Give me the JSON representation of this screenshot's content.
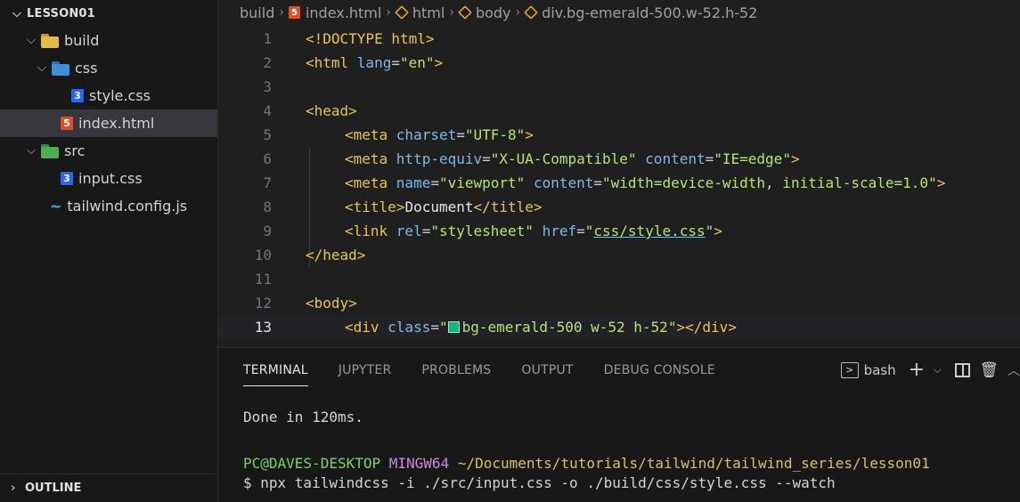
{
  "explorer": {
    "root": "LESSON01",
    "items": [
      {
        "label": "build",
        "type": "folder",
        "color": "#e8b94a"
      },
      {
        "label": "css",
        "type": "folder",
        "color": "#3f8fd6"
      },
      {
        "label": "style.css",
        "type": "css-file"
      },
      {
        "label": "index.html",
        "type": "html-file"
      },
      {
        "label": "src",
        "type": "folder",
        "color": "#4caf50"
      },
      {
        "label": "input.css",
        "type": "css-file"
      },
      {
        "label": "tailwind.config.js",
        "type": "tailwind-file"
      }
    ],
    "outline_label": "OUTLINE"
  },
  "breadcrumb": {
    "folder": "build",
    "file": "index.html",
    "html": "html",
    "body": "body",
    "element": "div.bg-emerald-500.w-52.h-52"
  },
  "editor": {
    "current_line": 13,
    "line_numbers": [
      "1",
      "2",
      "3",
      "4",
      "5",
      "6",
      "7",
      "8",
      "9",
      "10",
      "11",
      "12",
      "13"
    ],
    "code": {
      "l1_doctype": "<!DOCTYPE html>",
      "l2_open": "<html ",
      "l2_attr": "lang",
      "l2_eq": "=",
      "l2_val": "\"en\"",
      "l2_close": ">",
      "l4": "<head>",
      "l5_tag": "<meta ",
      "l5_attr": "charset",
      "l5_val": "\"UTF-8\"",
      "l6_tag": "<meta ",
      "l6_attr1": "http-equiv",
      "l6_val1": "\"X-UA-Compatible\"",
      "l6_attr2": "content",
      "l6_val2": "\"IE=edge\"",
      "l7_tag": "<meta ",
      "l7_attr1": "name",
      "l7_val1": "\"viewport\"",
      "l7_attr2": "content",
      "l7_val2": "\"width=device-width, initial-scale=1.0\"",
      "l8_open": "<title>",
      "l8_text": "Document",
      "l8_close": "</title>",
      "l9_tag": "<link ",
      "l9_attr1": "rel",
      "l9_val1": "\"stylesheet\"",
      "l9_attr2": "href",
      "l9_val2_q1": "\"",
      "l9_val2": "css/style.css",
      "l9_val2_q2": "\"",
      "l10": "</head>",
      "l12": "<body>",
      "l13_tag": "<div ",
      "l13_attr": "class",
      "l13_q1": "\"",
      "l13_val": "bg-emerald-500 w-52 h-52",
      "l13_q2": "\"",
      "l13_close": "></div>",
      "swatch_color": "#10b981"
    }
  },
  "panel": {
    "tabs": [
      "TERMINAL",
      "JUPYTER",
      "PROBLEMS",
      "OUTPUT",
      "DEBUG CONSOLE"
    ],
    "active_tab": "TERMINAL",
    "shell_label": "bash",
    "terminal": {
      "done_line": "Done in 120ms.",
      "prompt_user": "PC@DAVES-DESKTOP",
      "prompt_env": "MINGW64",
      "prompt_path": "~/Documents/tutorials/tailwind/tailwind_series/lesson01",
      "command": "$ npx tailwindcss -i ./src/input.css -o ./build/css/style.css --watch"
    }
  }
}
